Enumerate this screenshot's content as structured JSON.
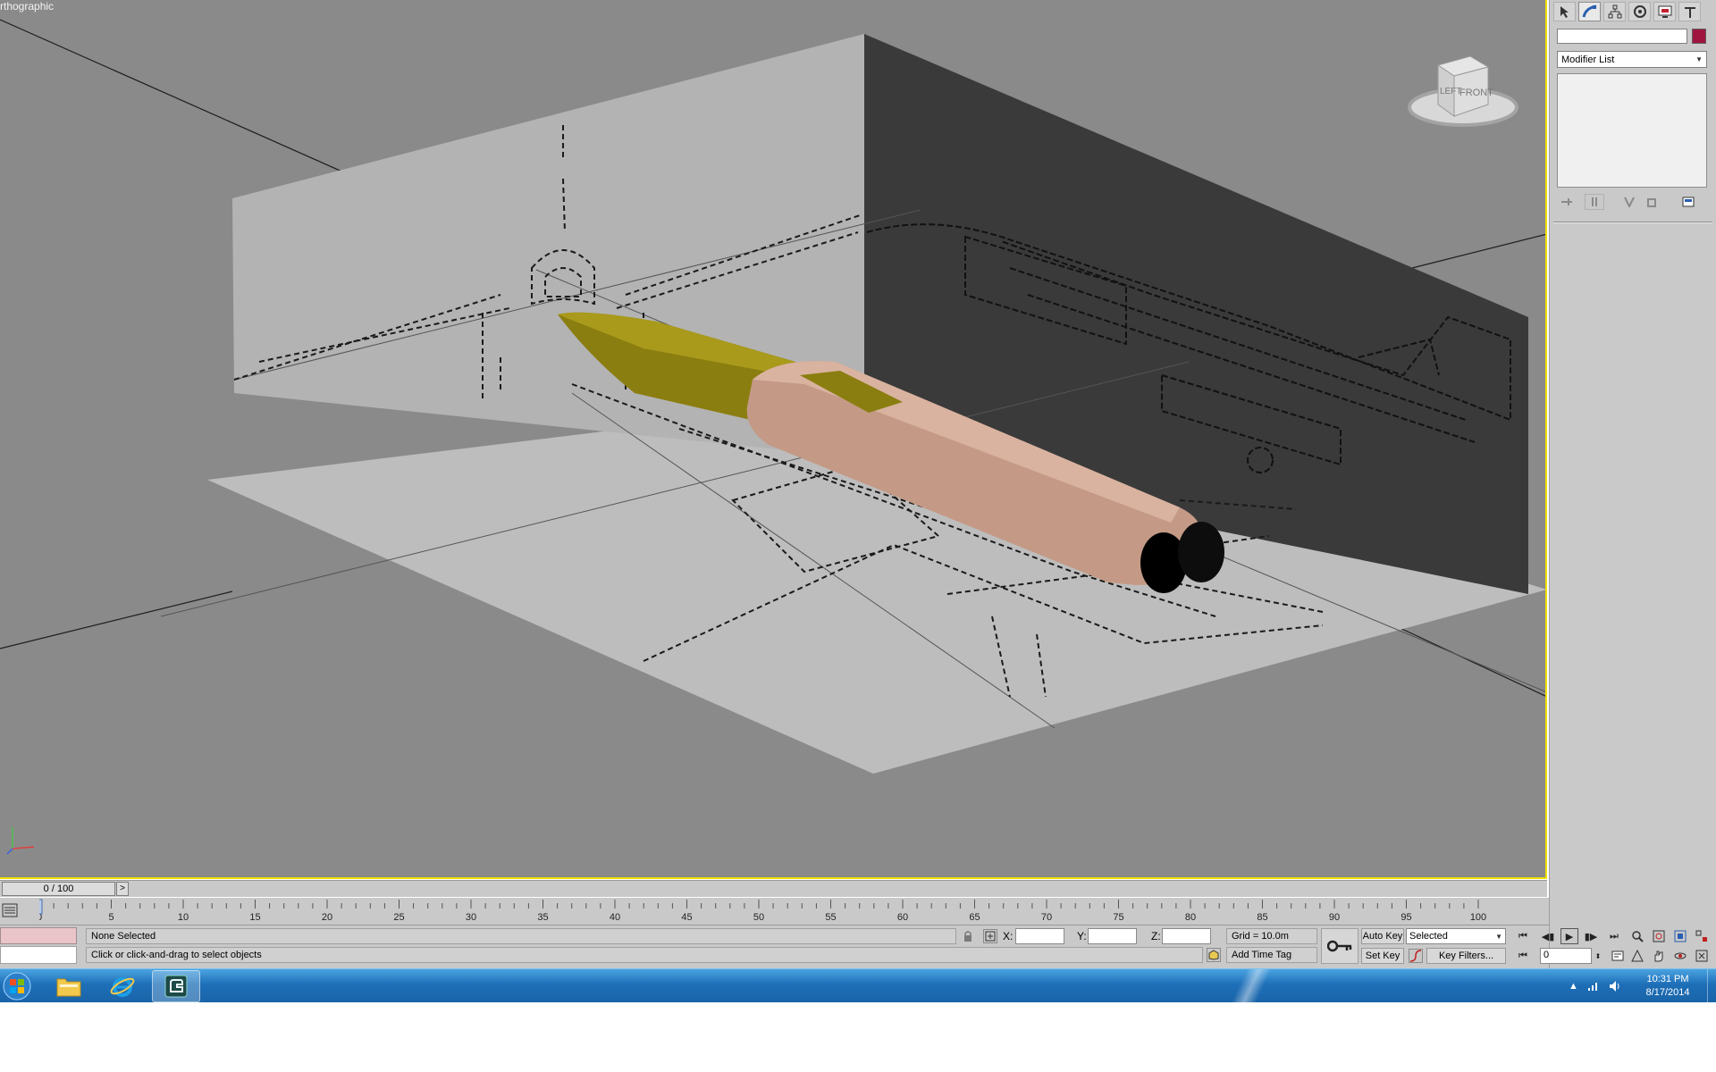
{
  "viewport": {
    "label": "rthographic",
    "viewcube": {
      "left_face": "LEFT",
      "front_face": "FRONT"
    },
    "colors": {
      "background": "#8a8a8a",
      "active_border": "#f0e000",
      "nose": "#8b7e10",
      "fuselage": "#c49a86",
      "back_panel": "#3a3a3a",
      "side_panel": "#b3b3b3",
      "floor_panel": "#bdbdbd"
    }
  },
  "command_panel": {
    "tabs": [
      {
        "icon": "cursor-icon"
      },
      {
        "icon": "modify-icon"
      },
      {
        "icon": "hierarchy-icon"
      },
      {
        "icon": "motion-icon"
      },
      {
        "icon": "display-icon"
      },
      {
        "icon": "utilities-icon"
      }
    ],
    "name_value": "",
    "object_color": "#a0153e",
    "modifier_list_label": "Modifier List"
  },
  "timeline": {
    "slider_label": "0 / 100",
    "slider_next": ">",
    "ticks": [
      "0",
      "5",
      "10",
      "15",
      "20",
      "25",
      "30",
      "35",
      "40",
      "45",
      "50",
      "55",
      "60",
      "65",
      "70",
      "75",
      "80",
      "85",
      "90",
      "95",
      "100"
    ]
  },
  "status": {
    "selection": "None Selected",
    "prompt": "Click or click-and-drag to select objects",
    "x_label": "X:",
    "y_label": "Y:",
    "z_label": "Z:",
    "x_value": "",
    "y_value": "",
    "z_value": "",
    "grid": "Grid = 10.0m",
    "add_time_tag": "Add Time Tag"
  },
  "animation": {
    "auto_key": "Auto Key",
    "set_key": "Set Key",
    "selected_option": "Selected",
    "key_filters": "Key Filters...",
    "current_frame": "0"
  },
  "taskbar": {
    "apps": [
      {
        "name": "explorer",
        "icon": "folder-icon"
      },
      {
        "name": "internet-explorer",
        "icon": "ie-icon"
      },
      {
        "name": "3ds-max",
        "icon": "max-icon"
      }
    ],
    "time": "10:31 PM",
    "date": "8/17/2014"
  }
}
